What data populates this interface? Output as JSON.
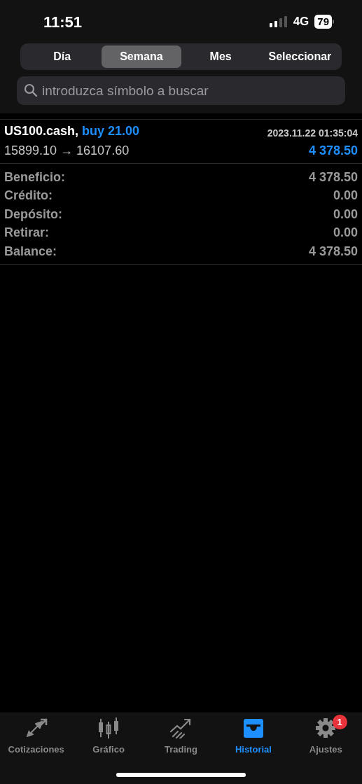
{
  "status_bar": {
    "time": "11:51",
    "network": "4G",
    "battery": "79"
  },
  "period_tabs": [
    {
      "label": "Día",
      "selected": false
    },
    {
      "label": "Semana",
      "selected": true
    },
    {
      "label": "Mes",
      "selected": false
    },
    {
      "label": "Seleccionar",
      "selected": false
    }
  ],
  "search": {
    "placeholder": "introduzca símbolo a buscar"
  },
  "deals": [
    {
      "symbol": "US100.cash,",
      "action": "buy 21.00",
      "time": "2023.11.22 01:35:04",
      "prices": "15899.10 → 16107.60",
      "profit": "4 378.50"
    }
  ],
  "summary": [
    {
      "label": "Beneficio:",
      "value": "4 378.50"
    },
    {
      "label": "Crédito:",
      "value": "0.00"
    },
    {
      "label": "Depósito:",
      "value": "0.00"
    },
    {
      "label": "Retirar:",
      "value": "0.00"
    },
    {
      "label": "Balance:",
      "value": "4 378.50"
    }
  ],
  "bottom_tabs": [
    {
      "label": "Cotizaciones",
      "selected": false
    },
    {
      "label": "Gráfico",
      "selected": false
    },
    {
      "label": "Trading",
      "selected": false
    },
    {
      "label": "Historial",
      "selected": true
    },
    {
      "label": "Ajustes",
      "selected": false,
      "badge": "1"
    }
  ]
}
